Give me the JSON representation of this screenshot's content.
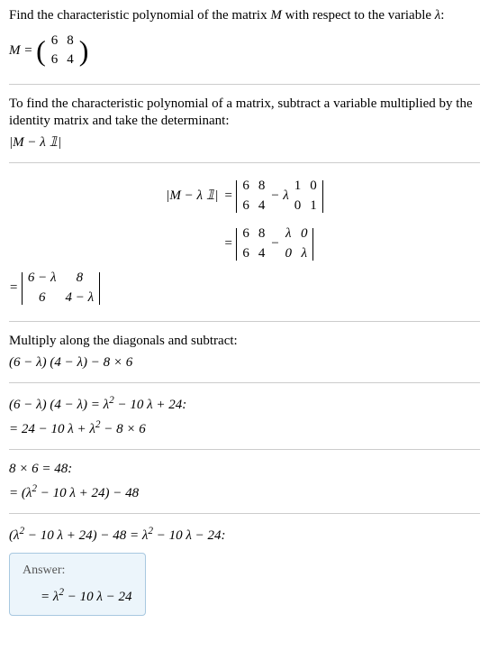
{
  "s1": {
    "line1a": "Find the characteristic polynomial of the matrix ",
    "line1b": " with respect to the variable ",
    "var_M": "M",
    "var_lambda": "λ",
    "colon": ":",
    "eq_lhs": "M = ",
    "m": {
      "a": "6",
      "b": "8",
      "c": "6",
      "d": "4"
    }
  },
  "s2": {
    "text": "To find the characteristic polynomial of a matrix, subtract a variable multiplied by the identity matrix and take the determinant:",
    "expr": "|M − λ 𝟙|"
  },
  "s3": {
    "lhs": "|M − λ 𝟙| ",
    "eq": " = ",
    "m1": {
      "a": "6",
      "b": "8",
      "c": "6",
      "d": "4"
    },
    "minus_lambda": " − λ ",
    "id": {
      "a": "1",
      "b": "0",
      "c": "0",
      "d": "1"
    },
    "m2": {
      "a": "6",
      "b": "8",
      "c": "6",
      "d": "4"
    },
    "minus": " − ",
    "lam": {
      "a": "λ",
      "b": "0",
      "c": "0",
      "d": "λ"
    },
    "final_lhs": "= ",
    "fm": {
      "a": "6 − λ",
      "b": "8",
      "c": "6",
      "d": "4 − λ"
    }
  },
  "s4": {
    "text": "Multiply along the diagonals and subtract:",
    "expr": "(6 − λ) (4 − λ) − 8 × 6"
  },
  "s5": {
    "premise": "(6 − λ) (4 − λ) = λ",
    "sq1": "2",
    "premise2": " − 10 λ + 24:",
    "result1": " = 24 − 10 λ + λ",
    "sq2": "2",
    "result2": " − 8 × 6"
  },
  "s6": {
    "premise": "8 × 6 = 48:",
    "result1": " = (λ",
    "sq": "2",
    "result2": " − 10 λ + 24) − 48"
  },
  "s7": {
    "premise1": "(λ",
    "sq1": "2",
    "premise2": " − 10 λ + 24) − 48 = λ",
    "sq2": "2",
    "premise3": " − 10 λ − 24:",
    "answer_label": "Answer:",
    "answer1": " = λ",
    "sq3": "2",
    "answer2": " − 10 λ − 24"
  },
  "chart_data": {
    "type": "table",
    "title": "Characteristic polynomial derivation",
    "matrix_M": [
      [
        6,
        8
      ],
      [
        6,
        4
      ]
    ],
    "identity": [
      [
        1,
        0
      ],
      [
        0,
        1
      ]
    ],
    "lambda_I": [
      [
        "λ",
        0
      ],
      [
        0,
        "λ"
      ]
    ],
    "M_minus_lambda_I": [
      [
        "6 − λ",
        8
      ],
      [
        6,
        "4 − λ"
      ]
    ],
    "steps": [
      "(6 − λ)(4 − λ) − 8×6",
      "24 − 10λ + λ^2 − 8×6",
      "(λ^2 − 10λ + 24) − 48",
      "λ^2 − 10λ − 24"
    ],
    "result": "λ^2 − 10λ − 24"
  }
}
